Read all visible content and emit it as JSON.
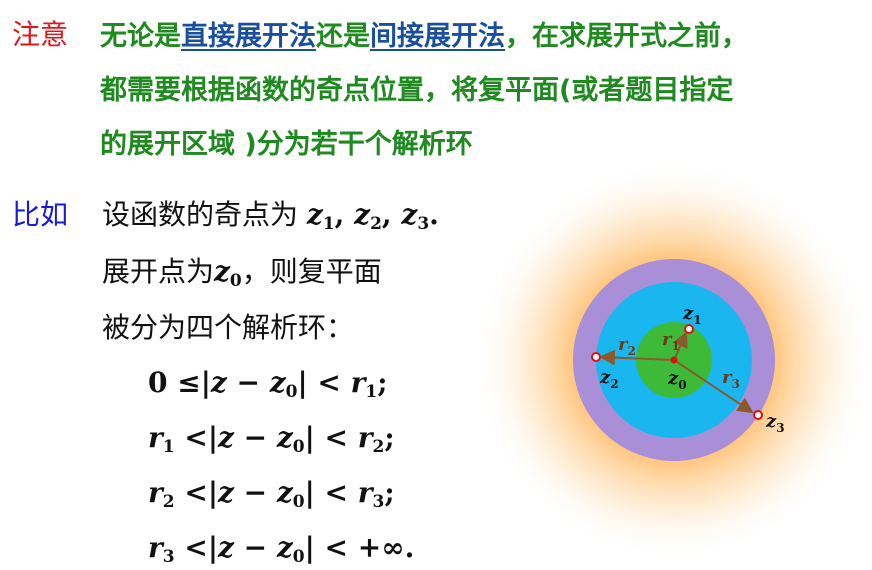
{
  "note": {
    "tag": "注意",
    "line1_pre": "无论是",
    "line1_link1": "直接展开法",
    "line1_mid": "还是",
    "line1_link2": "间接展开法",
    "line1_post": "，在求展开式之前，",
    "line2": "都需要根据函数的奇点位置，将复平面(或者题目指定",
    "line3": "的展开区域 )分为若干个解析环"
  },
  "example": {
    "tag": "比如",
    "line1_text": "设函数的奇点为",
    "line2_text": "展开点为",
    "line2_post": "，则复平面",
    "line3_text": "被分为四个解析环："
  },
  "symbols": {
    "z": "z",
    "r": "r",
    "sub1": "1",
    "sub2": "2",
    "sub3": "3",
    "sub0": "0",
    "comma": ",",
    "period": "."
  },
  "rings": [
    {
      "lhs": "0 ≤",
      "mid": "|z − z",
      "mid_sub": "0",
      "rel": "| <",
      "rhs": "r",
      "rhs_sub": "1",
      "end": ";"
    },
    {
      "lhs": "r",
      "lhs_sub": "1",
      "lt": " <",
      "mid": "|z − z",
      "mid_sub": "0",
      "rel": "| <",
      "rhs": "r",
      "rhs_sub": "2",
      "end": ";"
    },
    {
      "lhs": "r",
      "lhs_sub": "2",
      "lt": " <",
      "mid": "|z − z",
      "mid_sub": "0",
      "rel": "| <",
      "rhs": "r",
      "rhs_sub": "3",
      "end": ";"
    },
    {
      "lhs": "r",
      "lhs_sub": "3",
      "lt": " <",
      "mid": "|z − z",
      "mid_sub": "0",
      "rel": "| <",
      "rhs": "+∞",
      "end": "."
    }
  ],
  "diagram": {
    "labels": {
      "z1": "z",
      "z1_sub": "1",
      "z2": "z",
      "z2_sub": "2",
      "z3": "z",
      "z3_sub": "3",
      "z0": "z",
      "z0_sub": "0",
      "r1": "r",
      "r1_sub": "1",
      "r2": "r",
      "r2_sub": "2",
      "r3": "r",
      "r3_sub": "3"
    },
    "colors": {
      "outer": "#a98fd8",
      "middle": "#19b6f0",
      "inner": "#3cba38",
      "glow": "#ffb347",
      "arrow": "#8a5a2c",
      "point": "#e01010"
    }
  }
}
